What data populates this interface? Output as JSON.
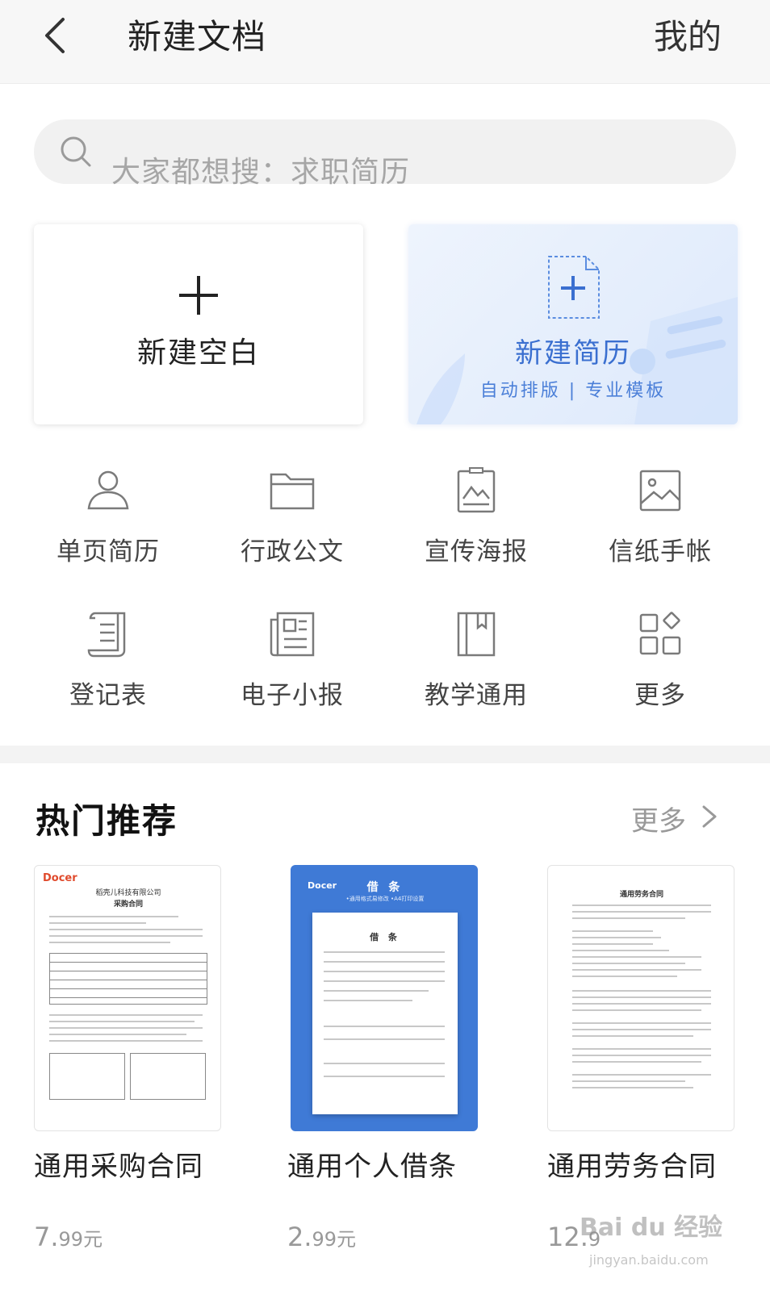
{
  "header": {
    "title": "新建文档",
    "mine": "我的"
  },
  "search": {
    "placeholder": "大家都想搜：求职简历"
  },
  "cards": {
    "blank": {
      "label": "新建空白"
    },
    "resume": {
      "label": "新建简历",
      "subtitle": "自动排版 | 专业模板"
    }
  },
  "categories": [
    {
      "label": "单页简历",
      "icon": "person-icon"
    },
    {
      "label": "行政公文",
      "icon": "folder-icon"
    },
    {
      "label": "宣传海报",
      "icon": "poster-icon"
    },
    {
      "label": "信纸手帐",
      "icon": "image-icon"
    },
    {
      "label": "登记表",
      "icon": "scroll-icon"
    },
    {
      "label": "电子小报",
      "icon": "newspaper-icon"
    },
    {
      "label": "教学通用",
      "icon": "book-icon"
    },
    {
      "label": "更多",
      "icon": "grid-icon"
    }
  ],
  "hot": {
    "title": "热门推荐",
    "more": "更多",
    "items": [
      {
        "name": "通用采购合同",
        "price_main": "7.",
        "price_rest": "99元",
        "thumb": {
          "brand": "Docer",
          "company": "稻壳儿科技有限公司",
          "doc_title": "采购合同"
        }
      },
      {
        "name": "通用个人借条",
        "price_main": "2.",
        "price_rest": "99元",
        "thumb": {
          "brand": "Docer",
          "header": "借 条",
          "header_sub": "•通用格式易修改   •A4打印设置",
          "doc_title": "借 条"
        }
      },
      {
        "name": "通用劳务合同",
        "price_main": "12.",
        "price_rest": "9",
        "thumb": {
          "doc_title": "通用劳务合同"
        }
      }
    ]
  },
  "watermark": {
    "text": "Bai du 经验",
    "sub": "jingyan.baidu.com"
  },
  "colors": {
    "accent": "#3a6fd0",
    "icon_gray": "#7a7a7a",
    "divider": "#f3f3f3",
    "resume_thumb_blue": "#3f7ad6"
  }
}
